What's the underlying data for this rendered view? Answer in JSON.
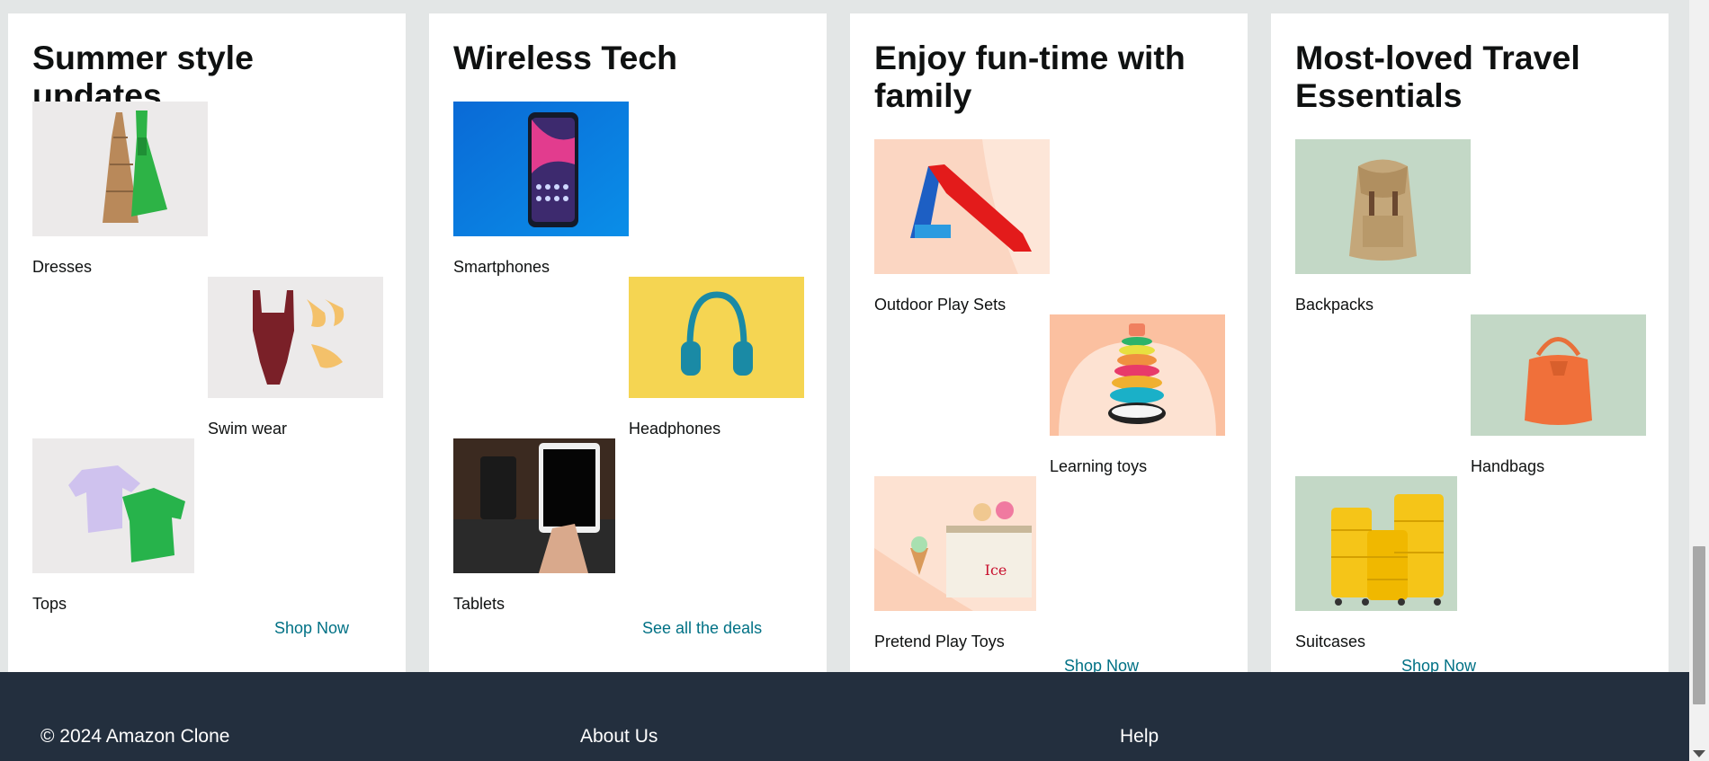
{
  "cards": [
    {
      "title": "Summer style updates",
      "items": [
        {
          "label": "Dresses",
          "icon": "dresses-image"
        },
        {
          "label": "Swim wear",
          "icon": "swimwear-image"
        },
        {
          "label": "Tops",
          "icon": "tops-image"
        }
      ],
      "link": "Shop Now"
    },
    {
      "title": "Wireless Tech",
      "items": [
        {
          "label": "Smartphones",
          "icon": "smartphone-image"
        },
        {
          "label": "Headphones",
          "icon": "headphones-image"
        },
        {
          "label": "Tablets",
          "icon": "tablet-image"
        }
      ],
      "link": "See all the deals"
    },
    {
      "title": "Enjoy fun-time with family",
      "items": [
        {
          "label": "Outdoor Play Sets",
          "icon": "slide-image"
        },
        {
          "label": "Learning toys",
          "icon": "stacking-rings-image"
        },
        {
          "label": "Pretend Play Toys",
          "icon": "ice-cream-counter-image"
        }
      ],
      "link": "Shop Now"
    },
    {
      "title": "Most-loved Travel Essentials",
      "items": [
        {
          "label": "Backpacks",
          "icon": "backpack-image"
        },
        {
          "label": "Handbags",
          "icon": "handbag-image"
        },
        {
          "label": "Suitcases",
          "icon": "suitcase-image"
        }
      ],
      "link": "Shop Now"
    }
  ],
  "footer": {
    "copyright": "© 2024 Amazon Clone",
    "about": "About Us",
    "help": "Help"
  },
  "colors": {
    "page_bg": "#e3e6e6",
    "footer_bg": "#232f3e",
    "link": "#007185"
  }
}
